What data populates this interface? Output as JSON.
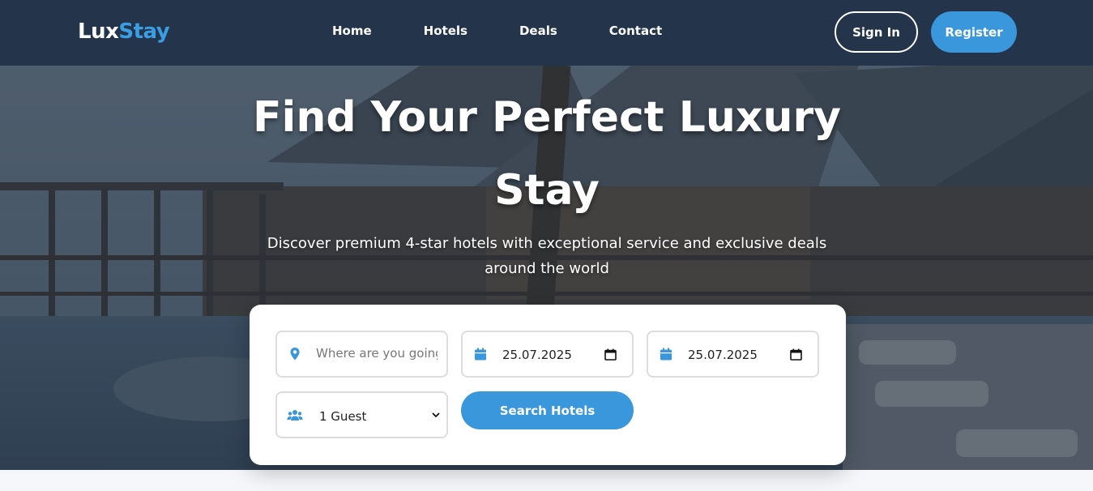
{
  "brand": {
    "name_part1": "Lux",
    "name_part2": "Stay"
  },
  "nav": {
    "items": [
      "Home",
      "Hotels",
      "Deals",
      "Contact"
    ]
  },
  "auth": {
    "signin_label": "Sign In",
    "register_label": "Register"
  },
  "hero": {
    "title": "Find Your Perfect Luxury Stay",
    "subtitle": "Discover premium 4-star hotels with exceptional service and exclusive deals around the world"
  },
  "search": {
    "destination_placeholder": "Where are you going?",
    "destination_value": "",
    "checkin_value": "25.07.2025",
    "checkout_value": "25.07.2025",
    "guests_selected": "1 Guest",
    "submit_label": "Search Hotels"
  },
  "icons": {
    "destination": "map-marker-icon",
    "checkin": "calendar-icon",
    "checkout": "calendar-icon",
    "guests": "users-icon"
  },
  "colors": {
    "accent": "#3a97dc",
    "navbar": "#24344a",
    "logo_accent": "#3a9ee4"
  }
}
